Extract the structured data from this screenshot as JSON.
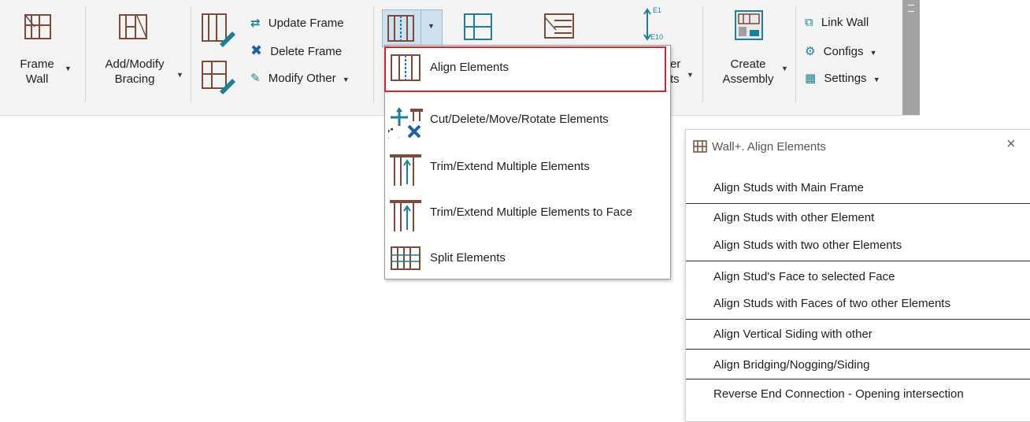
{
  "ribbon": {
    "frame_wall": {
      "line1": "Frame",
      "line2": "Wall"
    },
    "add_modify_bracing": {
      "line1": "Add/Modify",
      "line2": "Bracing"
    },
    "update_frame": "Update Frame",
    "delete_frame": "Delete Frame",
    "modify_other": "Modify Other",
    "partial_label_a": "er",
    "partial_label_b": "ts",
    "numbering_top": "E1",
    "numbering_bottom": "E10",
    "create_assembly": {
      "line1": "Create",
      "line2": "Assembly"
    },
    "link_wall": "Link Wall",
    "configs": "Configs",
    "settings": "Settings"
  },
  "dropdown": {
    "items": [
      {
        "label": "Align Elements",
        "icon": "align-elements-icon"
      },
      {
        "label": "Cut/Delete/Move/Rotate Elements",
        "icon": "cut-move-rotate-icon"
      },
      {
        "label": "Trim/Extend Multiple Elements",
        "icon": "trim-extend-icon"
      },
      {
        "label": "Trim/Extend Multiple Elements to Face",
        "icon": "trim-extend-face-icon"
      },
      {
        "label": "Split Elements",
        "icon": "split-elements-icon"
      }
    ]
  },
  "panel": {
    "title": "Wall+. Align Elements",
    "close": "×",
    "items": [
      "Align Studs with Main Frame",
      "Align Studs with other Element",
      "Align Studs with two other Elements",
      "Align Stud's Face to selected Face",
      "Align Studs with Faces of two other Elements",
      "Align Vertical Siding with other",
      "Align Bridging/Nogging/Siding",
      "Reverse End Connection - Opening intersection"
    ]
  },
  "colors": {
    "accent_teal": "#1b7f95",
    "icon_brown": "#7a4a3a",
    "highlight_red": "#e3202a",
    "close_x_blue": "#1f5fa8"
  }
}
